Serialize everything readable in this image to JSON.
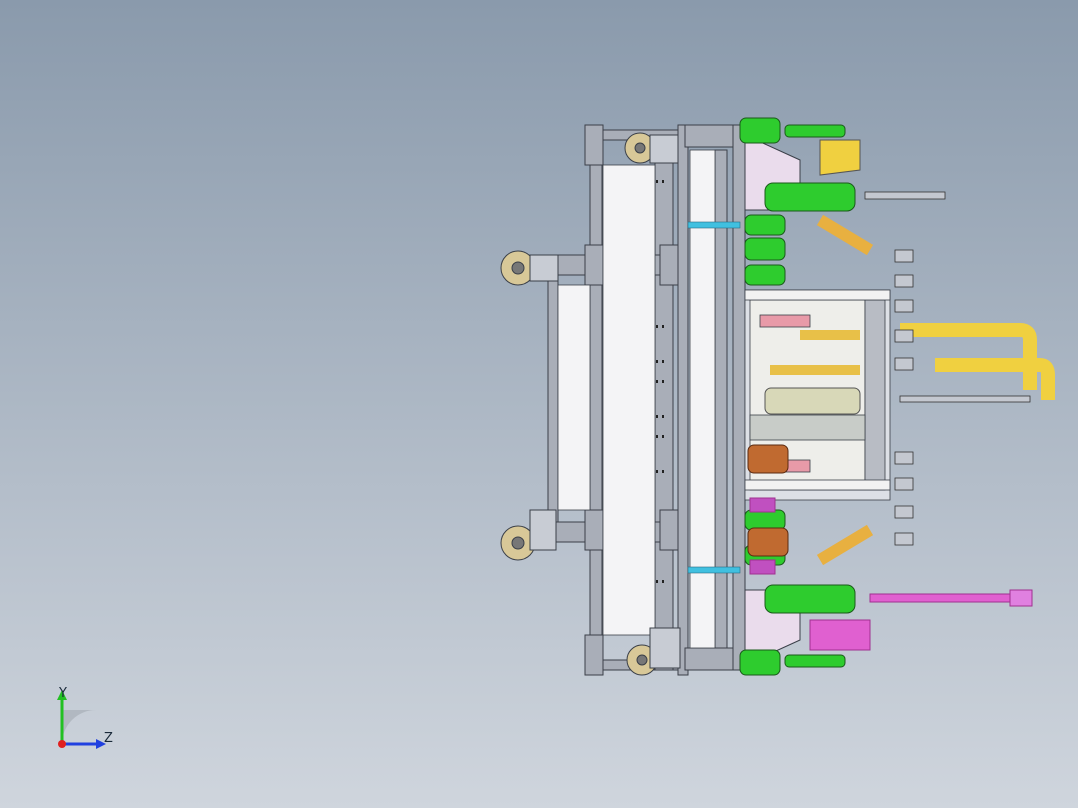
{
  "viewport": {
    "background_top": "#8a9aac",
    "background_bottom": "#cfd5dd"
  },
  "triad": {
    "y_label": "Y",
    "z_label": "Z",
    "y_color": "#22c022",
    "z_color": "#2040e0",
    "origin_color": "#e02020"
  },
  "model": {
    "frame_color": "#9ea4b0",
    "frame_edge": "#3a3f48",
    "cylinder_color": "#2ecc2e",
    "pipe_color": "#f0d040",
    "caster_color": "#d8c898",
    "accent_pink": "#e060d0",
    "accent_blue": "#40c0e0",
    "accent_orange": "#c06a30"
  }
}
